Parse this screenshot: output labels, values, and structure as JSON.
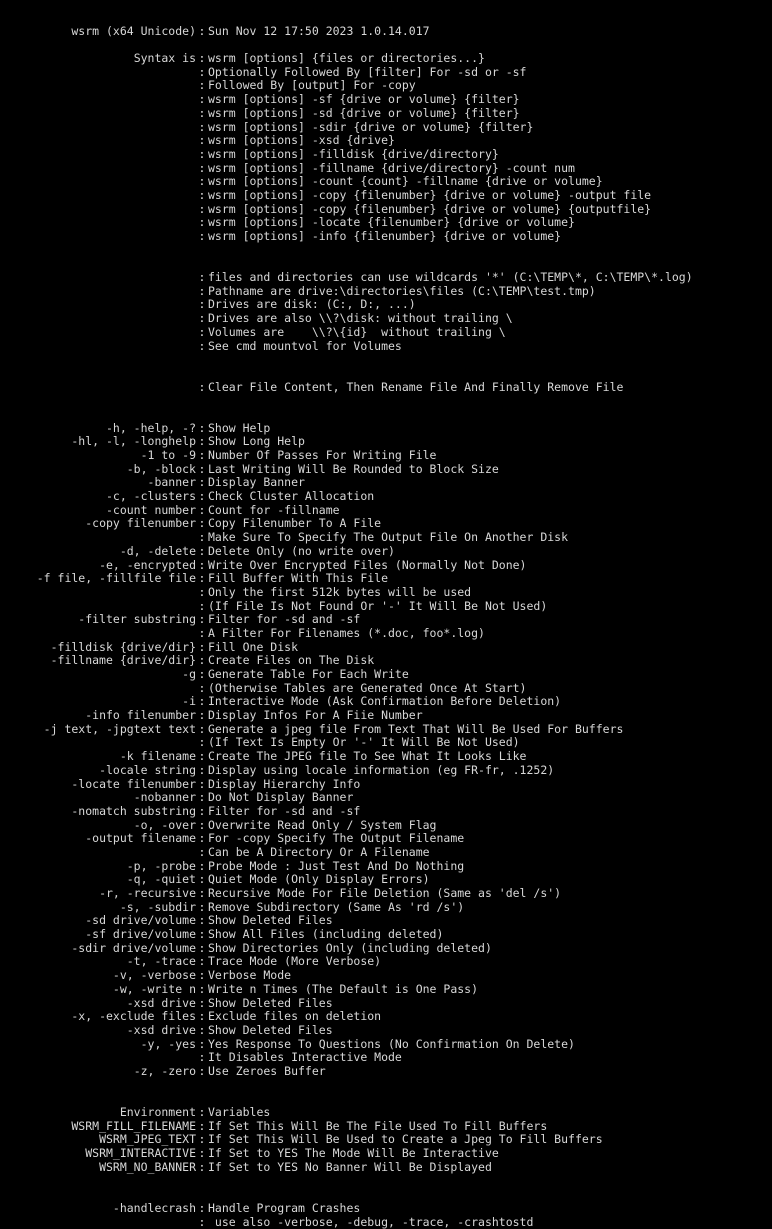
{
  "terminal": {
    "background": "#000000",
    "foreground": "#d8d8d8",
    "separator": ":",
    "program": "wsrm",
    "banner": {
      "left": "wsrm (x64 Unicode)",
      "right": "Sun Nov 12 17:50 2023 1.0.14.017"
    }
  },
  "lines": [
    {
      "type": "blank"
    },
    {
      "type": "pair",
      "left": "wsrm (x64 Unicode)",
      "right": "Sun Nov 12 17:50 2023 1.0.14.017"
    },
    {
      "type": "blank"
    },
    {
      "type": "pair",
      "left": "Syntax is",
      "right": "wsrm [options] {files or directories...}"
    },
    {
      "type": "pair",
      "left": "",
      "right": "Optionally Followed By [filter] For -sd or -sf"
    },
    {
      "type": "pair",
      "left": "",
      "right": "Followed By [output] For -copy"
    },
    {
      "type": "pair",
      "left": "",
      "right": "wsrm [options] -sf {drive or volume} {filter}"
    },
    {
      "type": "pair",
      "left": "",
      "right": "wsrm [options] -sd {drive or volume} {filter}"
    },
    {
      "type": "pair",
      "left": "",
      "right": "wsrm [options] -sdir {drive or volume} {filter}"
    },
    {
      "type": "pair",
      "left": "",
      "right": "wsrm [options] -xsd {drive}"
    },
    {
      "type": "pair",
      "left": "",
      "right": "wsrm [options] -filldisk {drive/directory}"
    },
    {
      "type": "pair",
      "left": "",
      "right": "wsrm [options] -fillname {drive/directory} -count num"
    },
    {
      "type": "pair",
      "left": "",
      "right": "wsrm [options] -count {count} -fillname {drive or volume}"
    },
    {
      "type": "pair",
      "left": "",
      "right": "wsrm [options] -copy {filenumber} {drive or volume} -output file"
    },
    {
      "type": "pair",
      "left": "",
      "right": "wsrm [options] -copy {filenumber} {drive or volume} {outputfile}"
    },
    {
      "type": "pair",
      "left": "",
      "right": "wsrm [options] -locate {filenumber} {drive or volume}"
    },
    {
      "type": "pair",
      "left": "",
      "right": "wsrm [options] -info {filenumber} {drive or volume}"
    },
    {
      "type": "blank"
    },
    {
      "type": "blank"
    },
    {
      "type": "pair",
      "left": "",
      "right": "files and directories can use wildcards '*' (C:\\TEMP\\*, C:\\TEMP\\*.log)"
    },
    {
      "type": "pair",
      "left": "",
      "right": "Pathname are drive:\\directories\\files (C:\\TEMP\\test.tmp)"
    },
    {
      "type": "pair",
      "left": "",
      "right": "Drives are disk: (C:, D:, ...)"
    },
    {
      "type": "pair",
      "left": "",
      "right": "Drives are also \\\\?\\disk: without trailing \\"
    },
    {
      "type": "pair",
      "left": "",
      "right": "Volumes are    \\\\?\\{id}  without trailing \\"
    },
    {
      "type": "pair",
      "left": "",
      "right": "See cmd mountvol for Volumes"
    },
    {
      "type": "blank"
    },
    {
      "type": "blank"
    },
    {
      "type": "pair",
      "left": "",
      "right": "Clear File Content, Then Rename File And Finally Remove File"
    },
    {
      "type": "blank"
    },
    {
      "type": "blank"
    },
    {
      "type": "pair",
      "left": "-h, -help, -?",
      "right": "Show Help"
    },
    {
      "type": "pair",
      "left": "-hl, -l, -longhelp",
      "right": "Show Long Help"
    },
    {
      "type": "pair",
      "left": "-1 to -9",
      "right": "Number Of Passes For Writing File"
    },
    {
      "type": "pair",
      "left": "-b, -block",
      "right": "Last Writing Will Be Rounded to Block Size"
    },
    {
      "type": "pair",
      "left": "-banner",
      "right": "Display Banner"
    },
    {
      "type": "pair",
      "left": "-c, -clusters",
      "right": "Check Cluster Allocation"
    },
    {
      "type": "pair",
      "left": "-count number",
      "right": "Count for -fillname"
    },
    {
      "type": "pair",
      "left": "-copy filenumber",
      "right": "Copy Filenumber To A File"
    },
    {
      "type": "pair",
      "left": "",
      "right": "Make Sure To Specify The Output File On Another Disk"
    },
    {
      "type": "pair",
      "left": "-d, -delete",
      "right": "Delete Only (no write over)"
    },
    {
      "type": "pair",
      "left": "-e, -encrypted",
      "right": "Write Over Encrypted Files (Normally Not Done)"
    },
    {
      "type": "pair",
      "left": "-f file, -fillfile file",
      "right": "Fill Buffer With This File"
    },
    {
      "type": "pair",
      "left": "",
      "right": "Only the first 512k bytes will be used"
    },
    {
      "type": "pair",
      "left": "",
      "right": "(If File Is Not Found Or '-' It Will Be Not Used)"
    },
    {
      "type": "pair",
      "left": "-filter substring",
      "right": "Filter for -sd and -sf"
    },
    {
      "type": "pair",
      "left": "",
      "right": "A Filter For Filenames (*.doc, foo*.log)"
    },
    {
      "type": "pair",
      "left": "-filldisk {drive/dir}",
      "right": "Fill One Disk"
    },
    {
      "type": "pair",
      "left": "-fillname {drive/dir}",
      "right": "Create Files on The Disk"
    },
    {
      "type": "pair",
      "left": "-g",
      "right": "Generate Table For Each Write"
    },
    {
      "type": "pair",
      "left": "",
      "right": "(Otherwise Tables are Generated Once At Start)"
    },
    {
      "type": "pair",
      "left": "-i",
      "right": "Interactive Mode (Ask Confirmation Before Deletion)"
    },
    {
      "type": "pair",
      "left": "-info filenumber",
      "right": "Display Infos For A Fiie Number"
    },
    {
      "type": "pair",
      "left": "-j text, -jpgtext text",
      "right": "Generate a jpeg file From Text That Will Be Used For Buffers"
    },
    {
      "type": "pair",
      "left": "",
      "right": "(If Text Is Empty Or '-' It Will Be Not Used)"
    },
    {
      "type": "pair",
      "left": "-k filename",
      "right": "Create The JPEG file To See What It Looks Like"
    },
    {
      "type": "pair",
      "left": "-locale string",
      "right": "Display using locale information (eg FR-fr, .1252)"
    },
    {
      "type": "pair",
      "left": "-locate filenumber",
      "right": "Display Hierarchy Info"
    },
    {
      "type": "pair",
      "left": "-nobanner",
      "right": "Do Not Display Banner"
    },
    {
      "type": "pair",
      "left": "-nomatch substring",
      "right": "Filter for -sd and -sf"
    },
    {
      "type": "pair",
      "left": "-o, -over",
      "right": "Overwrite Read Only / System Flag"
    },
    {
      "type": "pair",
      "left": "-output filename",
      "right": "For -copy Specify The Output Filename"
    },
    {
      "type": "pair",
      "left": "",
      "right": "Can be A Directory Or A Filename"
    },
    {
      "type": "pair",
      "left": "-p, -probe",
      "right": "Probe Mode : Just Test And Do Nothing"
    },
    {
      "type": "pair",
      "left": "-q, -quiet",
      "right": "Quiet Mode (Only Display Errors)"
    },
    {
      "type": "pair",
      "left": "-r, -recursive",
      "right": "Recursive Mode For File Deletion (Same as 'del /s')"
    },
    {
      "type": "pair",
      "left": "-s, -subdir",
      "right": "Remove Subdirectory (Same As 'rd /s')"
    },
    {
      "type": "pair",
      "left": "-sd drive/volume",
      "right": "Show Deleted Files"
    },
    {
      "type": "pair",
      "left": "-sf drive/volume",
      "right": "Show All Files (including deleted)"
    },
    {
      "type": "pair",
      "left": "-sdir drive/volume",
      "right": "Show Directories Only (including deleted)"
    },
    {
      "type": "pair",
      "left": "-t, -trace",
      "right": "Trace Mode (More Verbose)"
    },
    {
      "type": "pair",
      "left": "-v, -verbose",
      "right": "Verbose Mode"
    },
    {
      "type": "pair",
      "left": "-w, -write n",
      "right": "Write n Times (The Default is One Pass)"
    },
    {
      "type": "pair",
      "left": "-xsd drive",
      "right": "Show Deleted Files"
    },
    {
      "type": "pair",
      "left": "-x, -exclude files",
      "right": "Exclude files on deletion"
    },
    {
      "type": "pair",
      "left": "-xsd drive",
      "right": "Show Deleted Files"
    },
    {
      "type": "pair",
      "left": "-y, -yes",
      "right": "Yes Response To Questions (No Confirmation On Delete)"
    },
    {
      "type": "pair",
      "left": "",
      "right": "It Disables Interactive Mode"
    },
    {
      "type": "pair",
      "left": "-z, -zero",
      "right": "Use Zeroes Buffer"
    },
    {
      "type": "blank"
    },
    {
      "type": "blank"
    },
    {
      "type": "pair",
      "left": "Environment",
      "right": "Variables"
    },
    {
      "type": "pair",
      "left": "WSRM_FILL_FILENAME",
      "right": "If Set This Will Be The File Used To Fill Buffers"
    },
    {
      "type": "pair",
      "left": "WSRM_JPEG_TEXT",
      "right": "If Set This Will Be Used to Create a Jpeg To Fill Buffers"
    },
    {
      "type": "pair",
      "left": "WSRM_INTERACTIVE",
      "right": "If Set to YES The Mode Will Be Interactive"
    },
    {
      "type": "pair",
      "left": "WSRM_NO_BANNER",
      "right": "If Set to YES No Banner Will Be Displayed"
    },
    {
      "type": "blank"
    },
    {
      "type": "blank"
    },
    {
      "type": "pair",
      "left": "-handlecrash",
      "right": "Handle Program Crashes"
    },
    {
      "type": "pair",
      "left": "",
      "right": " use also -verbose, -debug, -trace, -crashtostd"
    }
  ]
}
